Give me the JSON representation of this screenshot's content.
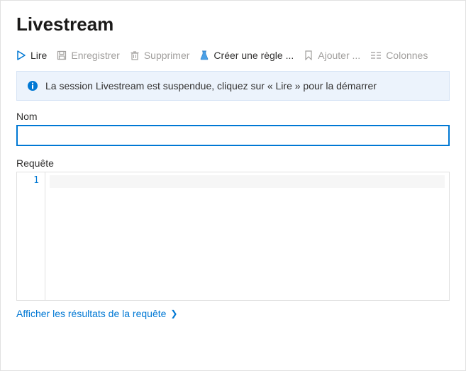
{
  "title": "Livestream",
  "toolbar": {
    "play": "Lire",
    "save": "Enregistrer",
    "delete": "Supprimer",
    "createRule": "Créer une règle ...",
    "add": "Ajouter ...",
    "columns": "Colonnes"
  },
  "info": {
    "message": "La session Livestream est suspendue, cliquez sur « Lire » pour la démarrer"
  },
  "fields": {
    "nameLabel": "Nom",
    "nameValue": "",
    "queryLabel": "Requête",
    "queryLineNumber": "1",
    "queryValue": ""
  },
  "links": {
    "showResults": "Afficher les résultats de la requête"
  },
  "colors": {
    "accent": "#0078d4",
    "disabled": "#a19f9d",
    "infoBg": "#ecf3fc"
  }
}
